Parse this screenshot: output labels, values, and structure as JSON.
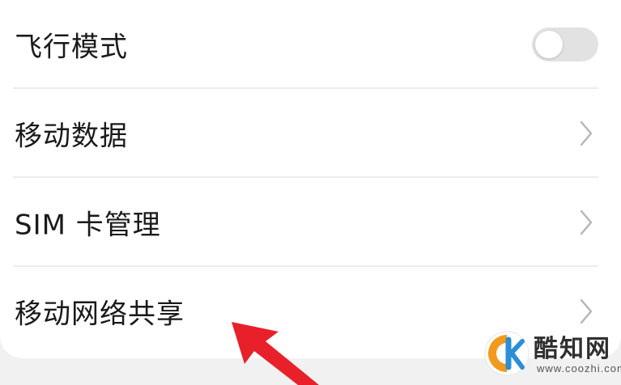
{
  "settings": {
    "items": [
      {
        "label": "飞行模式",
        "control": "toggle",
        "toggle_on": false
      },
      {
        "label": "移动数据",
        "control": "chevron"
      },
      {
        "label": "SIM 卡管理",
        "control": "chevron"
      },
      {
        "label": "移动网络共享",
        "control": "chevron"
      }
    ]
  },
  "annotation": {
    "icon": "red-arrow-pointer",
    "color": "#e8202a"
  },
  "watermark": {
    "name": "酷知网",
    "url": "www.coozhi.com",
    "logo_colors": [
      "#f29a1d",
      "#2a8fd6"
    ]
  },
  "colors": {
    "background": "#f1f1f1",
    "card": "#ffffff",
    "text": "#1a1a1a",
    "divider": "#ececec",
    "toggle_off": "#e2e2e2"
  }
}
